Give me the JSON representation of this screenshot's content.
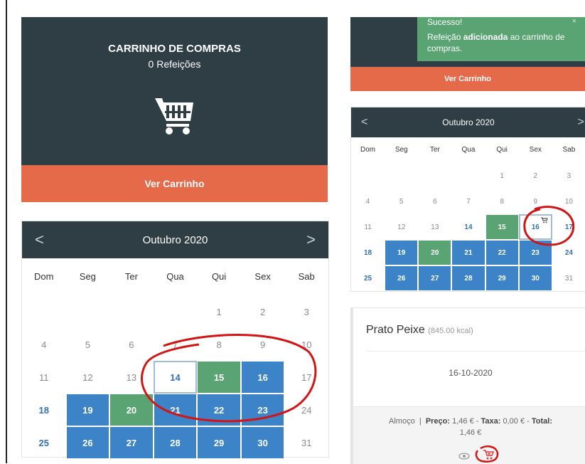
{
  "cart": {
    "title": "CARRINHO DE COMPRAS",
    "subtitle": "0 Refeições",
    "button": "Ver Carrinho"
  },
  "calendar": {
    "month": "Outubro 2020",
    "prev": "<",
    "next": ">",
    "weekdays": [
      "Dom",
      "Seg",
      "Ter",
      "Qua",
      "Qui",
      "Sex",
      "Sab"
    ],
    "days": [
      [
        "",
        "",
        "",
        "",
        "1",
        "2",
        "3"
      ],
      [
        "4",
        "5",
        "6",
        "7",
        "8",
        "9",
        "10"
      ],
      [
        "11",
        "12",
        "13",
        "14",
        "15",
        "16",
        "17"
      ],
      [
        "18",
        "19",
        "20",
        "21",
        "22",
        "23",
        "24"
      ],
      [
        "25",
        "26",
        "27",
        "28",
        "29",
        "30",
        "31"
      ]
    ],
    "states_left": [
      [
        "",
        "",
        "",
        "",
        "n",
        "n",
        "n"
      ],
      [
        "n",
        "n",
        "n",
        "n",
        "n",
        "n",
        "n"
      ],
      [
        "n",
        "n",
        "n",
        "ol",
        "g",
        "b",
        "n"
      ],
      [
        "tb",
        "b",
        "g",
        "b",
        "b",
        "b",
        "n"
      ],
      [
        "tb",
        "b",
        "b",
        "b",
        "b",
        "b",
        "n"
      ]
    ],
    "states_right": [
      [
        "",
        "",
        "",
        "",
        "n",
        "n",
        "n"
      ],
      [
        "n",
        "n",
        "n",
        "n",
        "n",
        "n",
        "n"
      ],
      [
        "n",
        "n",
        "n",
        "tb",
        "g",
        "ol",
        "tb"
      ],
      [
        "tb",
        "b",
        "g",
        "b",
        "b",
        "b",
        "tb"
      ],
      [
        "tb",
        "b",
        "b",
        "b",
        "b",
        "b",
        "n"
      ]
    ]
  },
  "notification": {
    "title": "Sucesso!",
    "message_prefix": "Refeição ",
    "message_bold": "adicionada",
    "message_suffix": " ao carrinho de compras.",
    "close": "×",
    "button": "Ver Carrinho"
  },
  "meal": {
    "name": "Prato Peixe",
    "kcal": "(845.00 kcal)",
    "date": "16-10-2020",
    "type": "Almoço",
    "separator": "|",
    "price_label": "Preço:",
    "price": "1,46 €",
    "tax_label": "Taxa:",
    "tax": "0,00 €",
    "total_label": "Total:",
    "total": "1,46 €"
  },
  "icons": {
    "cart": "shopping-cart-icon",
    "view": "eye-icon",
    "add_to_cart": "cart-add-icon"
  },
  "colors": {
    "panel": "#2f3d45",
    "accent": "#e56a4a",
    "booked_blue": "#3d83c8",
    "selected_green": "#5aa373",
    "annotation_red": "#d21414"
  }
}
